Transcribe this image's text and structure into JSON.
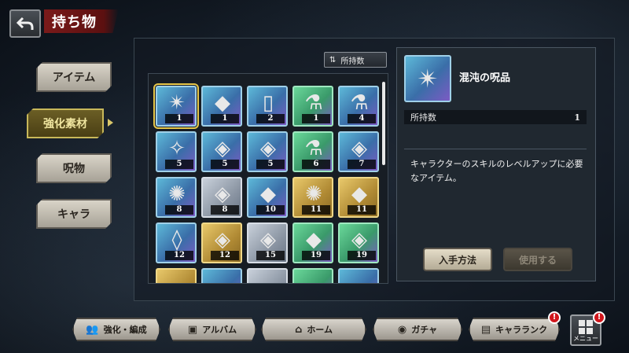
{
  "header": {
    "title": "持ち物"
  },
  "categories": [
    {
      "label": "アイテム",
      "active": false
    },
    {
      "label": "強化素材",
      "active": true
    },
    {
      "label": "呪物",
      "active": false
    },
    {
      "label": "キャラ",
      "active": false
    }
  ],
  "sort": {
    "label": "所持数"
  },
  "items": [
    {
      "count": "1",
      "rarity": "blue",
      "icon": "chaos-curse-artifact-icon",
      "glyph": "✴",
      "selected": true
    },
    {
      "count": "1",
      "rarity": "blue",
      "icon": "crystal-shard-icon",
      "glyph": "◆"
    },
    {
      "count": "2",
      "rarity": "blue",
      "icon": "scroll-gate-icon",
      "glyph": "▯"
    },
    {
      "count": "1",
      "rarity": "green",
      "icon": "red-potion-vial-icon",
      "glyph": "⚗"
    },
    {
      "count": "4",
      "rarity": "blue",
      "icon": "blue-potion-vial-icon",
      "glyph": "⚗"
    },
    {
      "count": "5",
      "rarity": "blue",
      "icon": "shattered-fragments-icon",
      "glyph": "✧"
    },
    {
      "count": "5",
      "rarity": "blue",
      "icon": "blue-flame-cube-icon",
      "glyph": "◈"
    },
    {
      "count": "5",
      "rarity": "blue",
      "icon": "red-flame-cube-icon",
      "glyph": "◈"
    },
    {
      "count": "6",
      "rarity": "green",
      "icon": "green-potion-vial-icon",
      "glyph": "⚗"
    },
    {
      "count": "7",
      "rarity": "blue",
      "icon": "blue-flame-cube-icon",
      "glyph": "◈"
    },
    {
      "count": "8",
      "rarity": "blue",
      "icon": "blue-flame-orb-icon",
      "glyph": "✺"
    },
    {
      "count": "8",
      "rarity": "silver",
      "icon": "blue-flame-cube-icon",
      "glyph": "◈"
    },
    {
      "count": "10",
      "rarity": "blue",
      "icon": "blue-flame-diamond-icon",
      "glyph": "◆"
    },
    {
      "count": "11",
      "rarity": "gold",
      "icon": "blue-flame-orb-icon",
      "glyph": "✺"
    },
    {
      "count": "11",
      "rarity": "gold",
      "icon": "blue-flame-diamond-icon",
      "glyph": "◆"
    },
    {
      "count": "12",
      "rarity": "blue",
      "icon": "small-crystal-icon",
      "glyph": "◊"
    },
    {
      "count": "12",
      "rarity": "gold",
      "icon": "blue-flame-cube-icon",
      "glyph": "◈"
    },
    {
      "count": "15",
      "rarity": "silver",
      "icon": "orange-flame-cube-icon",
      "glyph": "◈"
    },
    {
      "count": "19",
      "rarity": "green",
      "icon": "green-flame-diamond-icon",
      "glyph": "◆"
    },
    {
      "count": "19",
      "rarity": "green",
      "icon": "green-flame-cube-icon",
      "glyph": "◈"
    },
    {
      "count": "",
      "rarity": "gold",
      "icon": "partial-item-icon",
      "glyph": ""
    },
    {
      "count": "",
      "rarity": "blue",
      "icon": "partial-item-icon",
      "glyph": ""
    },
    {
      "count": "",
      "rarity": "silver",
      "icon": "partial-item-icon",
      "glyph": ""
    },
    {
      "count": "",
      "rarity": "green",
      "icon": "partial-item-icon",
      "glyph": ""
    },
    {
      "count": "",
      "rarity": "blue",
      "icon": "partial-item-icon",
      "glyph": ""
    }
  ],
  "detail": {
    "name": "混沌の呪品",
    "owned_label": "所持数",
    "owned_value": "1",
    "description": "キャラクターのスキルのレベルアップに必要なアイテム。",
    "acquire_label": "入手方法",
    "use_label": "使用する"
  },
  "nav": [
    {
      "label": "強化・編成",
      "icon": "team-upgrade-icon",
      "glyph": "👥",
      "badge": false
    },
    {
      "label": "アルバム",
      "icon": "album-icon",
      "glyph": "▣",
      "badge": false
    },
    {
      "label": "ホーム",
      "icon": "home-icon",
      "glyph": "⌂",
      "badge": false
    },
    {
      "label": "ガチャ",
      "icon": "gacha-icon",
      "glyph": "◉",
      "badge": false
    },
    {
      "label": "キャラランク",
      "icon": "character-rank-icon",
      "glyph": "▤",
      "badge": true
    }
  ],
  "badge_text": "!",
  "menu": {
    "label": "メニュー",
    "badge": true
  },
  "colors": {
    "selected_outline": "#e6c64a",
    "badge_red": "#d0161c",
    "title_banner": "#7a1a1a"
  }
}
